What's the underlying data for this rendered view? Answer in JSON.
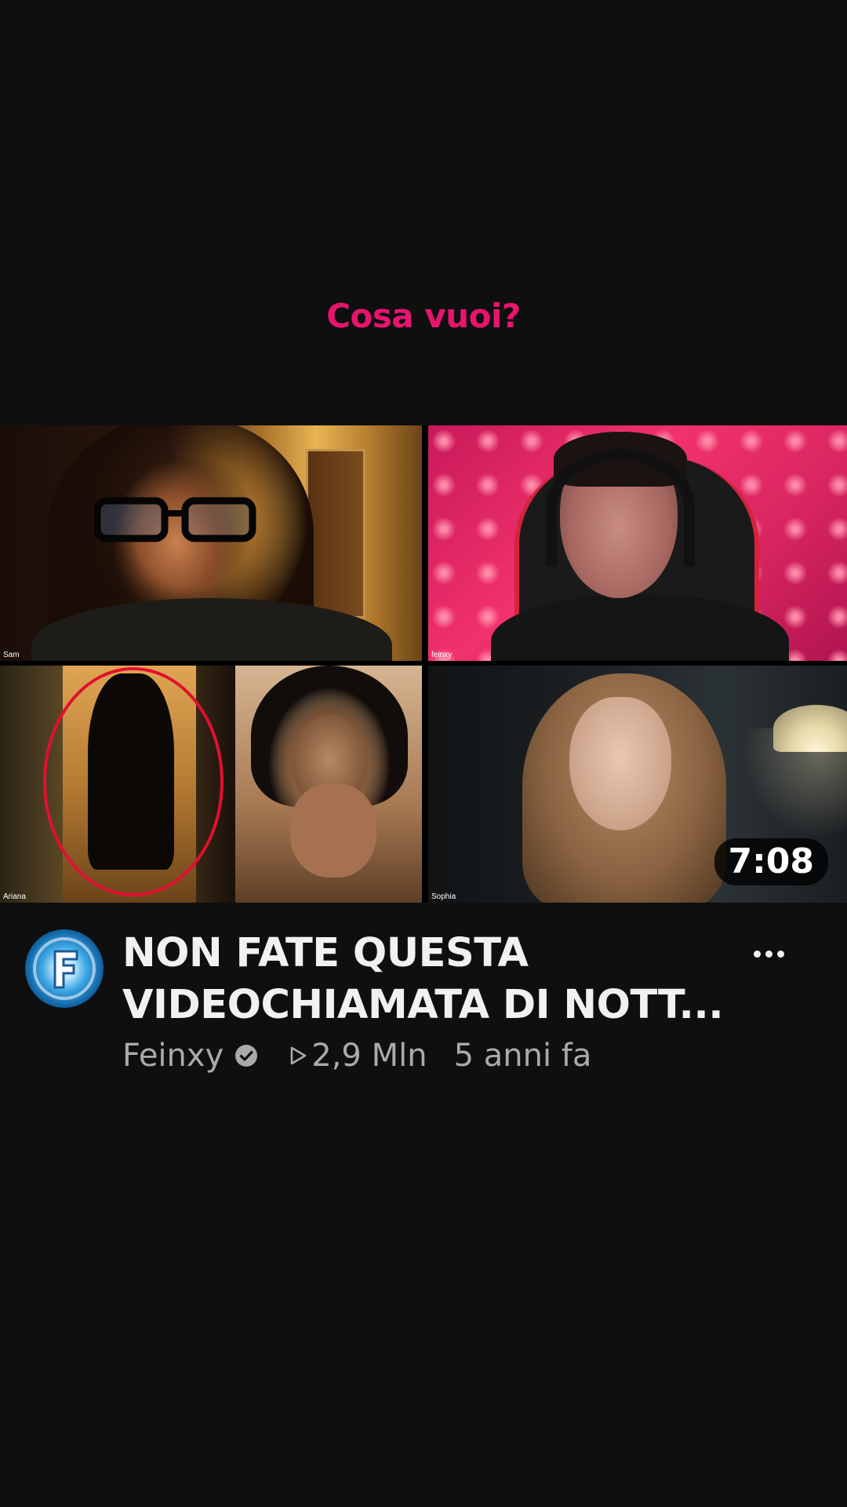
{
  "caption": "Cosa vuoi?",
  "thumbnail": {
    "participants": [
      "Sam",
      "feinxy",
      "Ariana",
      "Sophia"
    ],
    "duration": "7:08"
  },
  "video": {
    "title": "NON FATE QUESTA VIDEOCHIAMATA DI NOTT...",
    "channel": "Feinxy",
    "views": "2,9 Mln",
    "age": "5 anni fa",
    "channel_avatar_letter": "F"
  },
  "colors": {
    "caption": "#e8146e",
    "background": "#0f0f0f",
    "title": "#f1f1f1",
    "secondary_text": "#aaaaaa",
    "highlight_circle": "#e01030"
  },
  "icons": {
    "verified": "verified-check-icon",
    "views": "play-outline-icon",
    "more": "more-horizontal-icon"
  }
}
